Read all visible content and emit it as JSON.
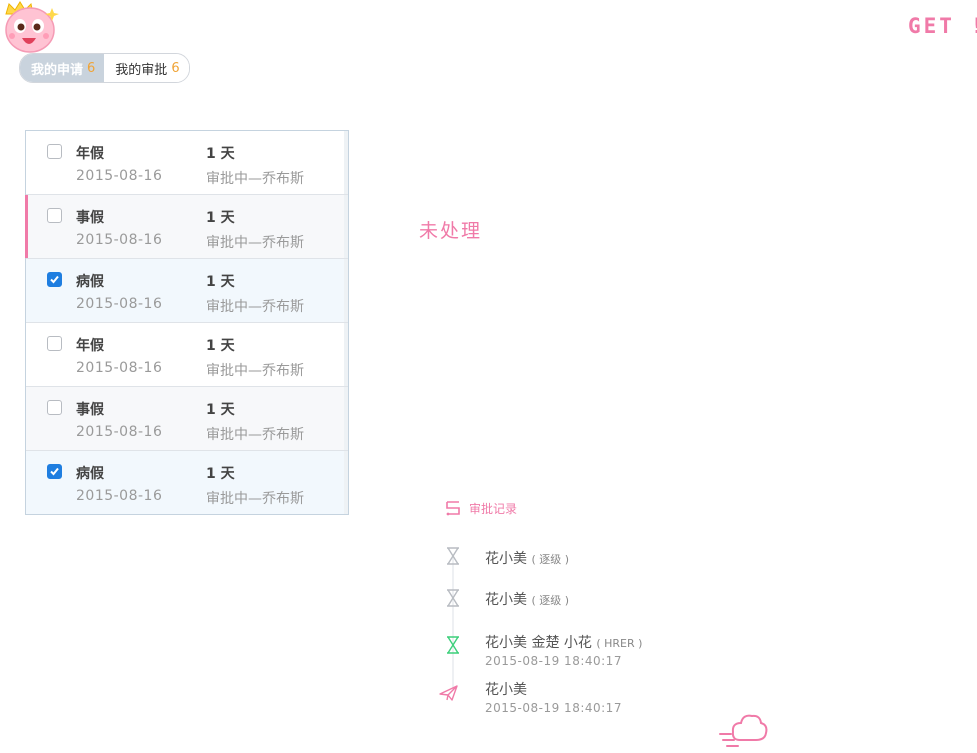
{
  "header": {
    "get_label": "GET !"
  },
  "tabs": [
    {
      "label": "我的申请",
      "count": "6",
      "active": true
    },
    {
      "label": "我的审批",
      "count": "6",
      "active": false
    }
  ],
  "requests": [
    {
      "type": "年假",
      "date": "2015-08-16",
      "duration": "1 天",
      "status": "审批中—乔布斯",
      "checked": false,
      "flagged": false
    },
    {
      "type": "事假",
      "date": "2015-08-16",
      "duration": "1 天",
      "status": "审批中—乔布斯",
      "checked": false,
      "flagged": true
    },
    {
      "type": "病假",
      "date": "2015-08-16",
      "duration": "1 天",
      "status": "审批中—乔布斯",
      "checked": true,
      "flagged": false
    },
    {
      "type": "年假",
      "date": "2015-08-16",
      "duration": "1 天",
      "status": "审批中—乔布斯",
      "checked": false,
      "flagged": false
    },
    {
      "type": "事假",
      "date": "2015-08-16",
      "duration": "1 天",
      "status": "审批中—乔布斯",
      "checked": false,
      "flagged": false
    },
    {
      "type": "病假",
      "date": "2015-08-16",
      "duration": "1 天",
      "status": "审批中—乔布斯",
      "checked": true,
      "flagged": false
    }
  ],
  "panel": {
    "unprocessed_label": "未处理"
  },
  "records": {
    "title": "审批记录",
    "items": [
      {
        "name": "花小美",
        "sub": "( 逐级 )",
        "time": "",
        "icon": "hourglass-icon",
        "color": "#b8bcc2"
      },
      {
        "name": "花小美",
        "sub": "( 逐级 )",
        "time": "",
        "icon": "hourglass-icon",
        "color": "#b8bcc2"
      },
      {
        "name": "花小美 金楚 小花",
        "sub": "( HRER )",
        "time": "2015-08-19  18:40:17",
        "icon": "hourglass-icon",
        "color": "#3ccf7a"
      },
      {
        "name": "花小美",
        "sub": "",
        "time": "2015-08-19  18:40:17",
        "icon": "paper-plane-icon",
        "color": "#f07aa8"
      }
    ]
  },
  "colors": {
    "accent_pink": "#f07aa8",
    "check_blue": "#1f7ee0",
    "count_orange": "#f0a437",
    "done_green": "#3ccf7a"
  }
}
